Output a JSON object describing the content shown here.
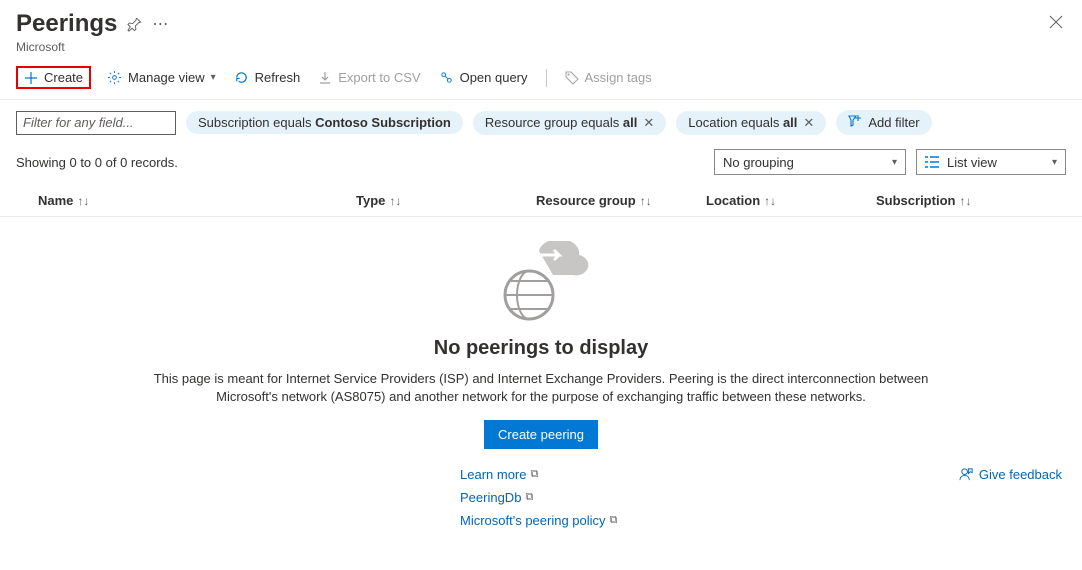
{
  "header": {
    "title": "Peerings",
    "subtitle": "Microsoft"
  },
  "toolbar": {
    "create": "Create",
    "manage_view": "Manage view",
    "refresh": "Refresh",
    "export_csv": "Export to CSV",
    "open_query": "Open query",
    "assign_tags": "Assign tags"
  },
  "filters": {
    "placeholder": "Filter for any field...",
    "pill_sub_prefix": "Subscription equals ",
    "pill_sub_value": "Contoso Subscription",
    "pill_rg_prefix": "Resource group equals ",
    "pill_rg_value": "all",
    "pill_loc_prefix": "Location equals ",
    "pill_loc_value": "all",
    "add_filter": "Add filter"
  },
  "status": {
    "text": "Showing 0 to 0 of 0 records.",
    "grouping": "No grouping",
    "listview": "List view"
  },
  "columns": {
    "name": "Name",
    "type": "Type",
    "rg": "Resource group",
    "location": "Location",
    "subscription": "Subscription"
  },
  "empty": {
    "title": "No peerings to display",
    "desc": "This page is meant for Internet Service Providers (ISP) and Internet Exchange Providers. Peering is the direct interconnection between Microsoft's network (AS8075) and another network for the purpose of exchanging traffic between these networks.",
    "cta": "Create peering",
    "links": {
      "learn": "Learn more",
      "peeringdb": "PeeringDb",
      "policy": "Microsoft's peering policy"
    },
    "feedback": "Give feedback"
  }
}
